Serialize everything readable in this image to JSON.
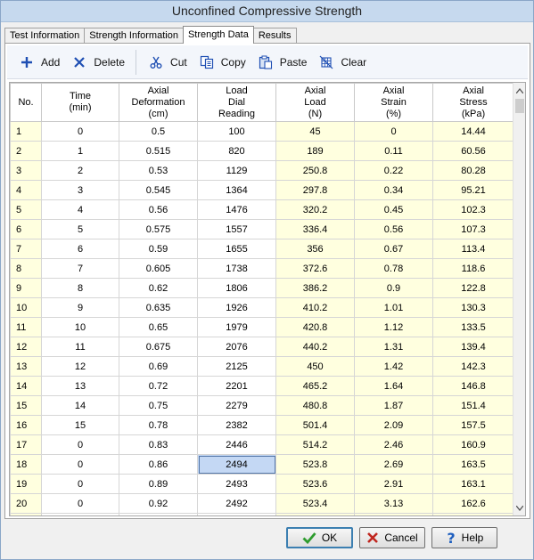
{
  "window": {
    "title": "Unconfined Compressive Strength"
  },
  "tabs": [
    {
      "label": "Test Information",
      "active": false
    },
    {
      "label": "Strength Information",
      "active": false
    },
    {
      "label": "Strength Data",
      "active": true
    },
    {
      "label": "Results",
      "active": false
    }
  ],
  "toolbar": {
    "add_label": "Add",
    "delete_label": "Delete",
    "cut_label": "Cut",
    "copy_label": "Copy",
    "paste_label": "Paste",
    "clear_label": "Clear"
  },
  "colors": {
    "readonly_cell": "#ffffdf",
    "selected_cell": "#c4d8f4",
    "add_icon": "#1f4fb3",
    "delete_icon": "#1f4fb3"
  },
  "grid": {
    "columns": [
      "No.",
      "Time\n(min)",
      "Axial\nDeformation\n(cm)",
      "Load\nDial\nReading",
      "Axial\nLoad\n(N)",
      "Axial\nStrain\n(%)",
      "Axial\nStress\n(kPa)"
    ],
    "selected": {
      "row": 17,
      "col": 3
    },
    "rows": [
      [
        "1",
        "0",
        "0.5",
        "100",
        "45",
        "0",
        "14.44"
      ],
      [
        "2",
        "1",
        "0.515",
        "820",
        "189",
        "0.11",
        "60.56"
      ],
      [
        "3",
        "2",
        "0.53",
        "1129",
        "250.8",
        "0.22",
        "80.28"
      ],
      [
        "4",
        "3",
        "0.545",
        "1364",
        "297.8",
        "0.34",
        "95.21"
      ],
      [
        "5",
        "4",
        "0.56",
        "1476",
        "320.2",
        "0.45",
        "102.3"
      ],
      [
        "6",
        "5",
        "0.575",
        "1557",
        "336.4",
        "0.56",
        "107.3"
      ],
      [
        "7",
        "6",
        "0.59",
        "1655",
        "356",
        "0.67",
        "113.4"
      ],
      [
        "8",
        "7",
        "0.605",
        "1738",
        "372.6",
        "0.78",
        "118.6"
      ],
      [
        "9",
        "8",
        "0.62",
        "1806",
        "386.2",
        "0.9",
        "122.8"
      ],
      [
        "10",
        "9",
        "0.635",
        "1926",
        "410.2",
        "1.01",
        "130.3"
      ],
      [
        "11",
        "10",
        "0.65",
        "1979",
        "420.8",
        "1.12",
        "133.5"
      ],
      [
        "12",
        "11",
        "0.675",
        "2076",
        "440.2",
        "1.31",
        "139.4"
      ],
      [
        "13",
        "12",
        "0.69",
        "2125",
        "450",
        "1.42",
        "142.3"
      ],
      [
        "14",
        "13",
        "0.72",
        "2201",
        "465.2",
        "1.64",
        "146.8"
      ],
      [
        "15",
        "14",
        "0.75",
        "2279",
        "480.8",
        "1.87",
        "151.4"
      ],
      [
        "16",
        "15",
        "0.78",
        "2382",
        "501.4",
        "2.09",
        "157.5"
      ],
      [
        "17",
        "0",
        "0.83",
        "2446",
        "514.2",
        "2.46",
        "160.9"
      ],
      [
        "18",
        "0",
        "0.86",
        "2494",
        "523.8",
        "2.69",
        "163.5"
      ],
      [
        "19",
        "0",
        "0.89",
        "2493",
        "523.6",
        "2.91",
        "163.1"
      ],
      [
        "20",
        "0",
        "0.92",
        "2492",
        "523.4",
        "3.13",
        "162.6"
      ],
      [
        "",
        "",
        "",
        "",
        "",
        "",
        ""
      ]
    ]
  },
  "footer": {
    "ok_label": "OK",
    "cancel_label": "Cancel",
    "help_label": "Help"
  }
}
